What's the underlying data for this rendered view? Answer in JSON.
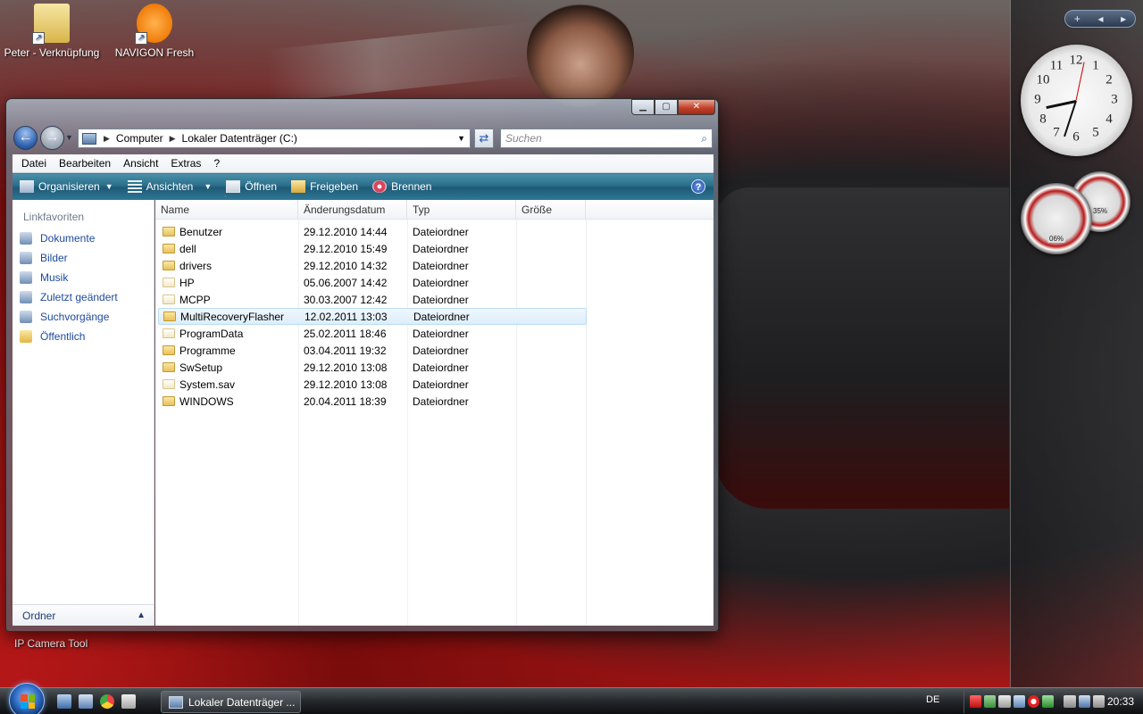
{
  "desktop": {
    "icons": [
      {
        "label": "Peter - Verknüpfung",
        "icon": "folder-shortcut-icon"
      },
      {
        "label": "NAVIGON Fresh",
        "icon": "navigon-icon"
      }
    ],
    "ipcam_label": "IP Camera Tool"
  },
  "sidebar": {
    "controls": {
      "add": "+",
      "prev": "◂",
      "next": "▸"
    },
    "clock": {
      "numbers": [
        "12",
        "1",
        "2",
        "3",
        "4",
        "5",
        "6",
        "7",
        "8",
        "9",
        "10",
        "11"
      ]
    },
    "gauges": {
      "cpu_readout": "06%",
      "mem_readout": "35%"
    }
  },
  "window": {
    "controls": {
      "minimize": "▁",
      "maximize": "▢",
      "close": "✕"
    },
    "address": {
      "crumbs": [
        "Computer",
        "Lokaler Datenträger (C:)"
      ]
    },
    "search": {
      "placeholder": "Suchen"
    },
    "menu": [
      "Datei",
      "Bearbeiten",
      "Ansicht",
      "Extras",
      "?"
    ],
    "commands": [
      {
        "label": "Organisieren",
        "icon": "organize-icon",
        "dropdown": true
      },
      {
        "label": "Ansichten",
        "icon": "views-icon",
        "dropdown": true
      },
      {
        "label": "Öffnen",
        "icon": "open-icon",
        "dropdown": false
      },
      {
        "label": "Freigeben",
        "icon": "share-icon",
        "dropdown": false
      },
      {
        "label": "Brennen",
        "icon": "burn-icon",
        "dropdown": false
      }
    ],
    "help": "?",
    "nav": {
      "header": "Linkfavoriten",
      "items": [
        {
          "label": "Dokumente",
          "icon": "documents-icon",
          "color": "#6f8fb4"
        },
        {
          "label": "Bilder",
          "icon": "pictures-icon",
          "color": "#6f8fb4"
        },
        {
          "label": "Musik",
          "icon": "music-icon",
          "color": "#6f8fb4"
        },
        {
          "label": "Zuletzt geändert",
          "icon": "recent-icon",
          "color": "#6f8fb4"
        },
        {
          "label": "Suchvorgänge",
          "icon": "searches-icon",
          "color": "#6f8fb4"
        },
        {
          "label": "Öffentlich",
          "icon": "public-folder-icon",
          "color": "#e2b642"
        }
      ],
      "folders_label": "Ordner"
    },
    "columns": [
      "Name",
      "Änderungsdatum",
      "Typ",
      "Größe"
    ],
    "files": [
      {
        "name": "Benutzer",
        "date": "29.12.2010 14:44",
        "type": "Dateiordner",
        "kind": "folder"
      },
      {
        "name": "dell",
        "date": "29.12.2010 15:49",
        "type": "Dateiordner",
        "kind": "folder"
      },
      {
        "name": "drivers",
        "date": "29.12.2010 14:32",
        "type": "Dateiordner",
        "kind": "folder"
      },
      {
        "name": "HP",
        "date": "05.06.2007 14:42",
        "type": "Dateiordner",
        "kind": "file"
      },
      {
        "name": "MCPP",
        "date": "30.03.2007 12:42",
        "type": "Dateiordner",
        "kind": "file"
      },
      {
        "name": "MultiRecoveryFlasher",
        "date": "12.02.2011 13:03",
        "type": "Dateiordner",
        "kind": "folder",
        "selected": true
      },
      {
        "name": "ProgramData",
        "date": "25.02.2011 18:46",
        "type": "Dateiordner",
        "kind": "file"
      },
      {
        "name": "Programme",
        "date": "03.04.2011 19:32",
        "type": "Dateiordner",
        "kind": "folder"
      },
      {
        "name": "SwSetup",
        "date": "29.12.2010 13:08",
        "type": "Dateiordner",
        "kind": "folder"
      },
      {
        "name": "System.sav",
        "date": "29.12.2010 13:08",
        "type": "Dateiordner",
        "kind": "file"
      },
      {
        "name": "WINDOWS",
        "date": "20.04.2011 18:39",
        "type": "Dateiordner",
        "kind": "folder"
      }
    ]
  },
  "taskbar": {
    "task_label": "Lokaler Datenträger ...",
    "language": "DE",
    "time": "20:33"
  }
}
